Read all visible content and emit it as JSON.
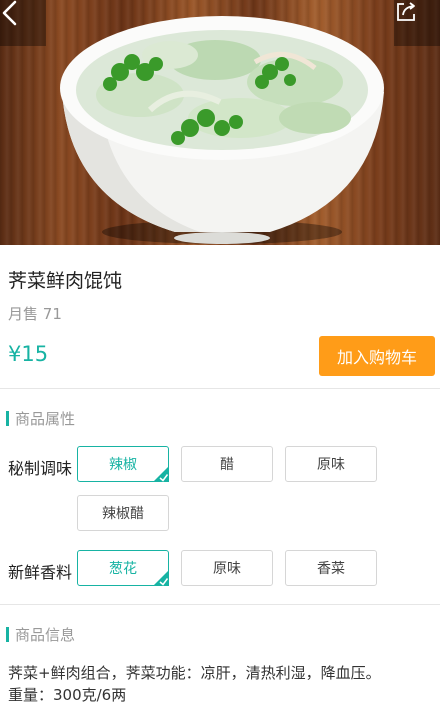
{
  "header": {
    "back_icon": "chevron-left-icon",
    "share_icon": "share-icon"
  },
  "product": {
    "name": "荠菜鲜肉馄饨",
    "sold_label": "月售",
    "sold_count": "71",
    "price": "¥15",
    "add_to_cart_label": "加入购物车"
  },
  "attributes": {
    "section_title": "商品属性",
    "groups": [
      {
        "label": "秘制调味",
        "options": [
          {
            "label": "辣椒",
            "selected": true
          },
          {
            "label": "醋",
            "selected": false
          },
          {
            "label": "原味",
            "selected": false
          },
          {
            "label": "辣椒醋",
            "selected": false
          }
        ]
      },
      {
        "label": "新鲜香料",
        "options": [
          {
            "label": "葱花",
            "selected": true
          },
          {
            "label": "原味",
            "selected": false
          },
          {
            "label": "香菜",
            "selected": false
          }
        ]
      }
    ]
  },
  "info": {
    "section_title": "商品信息",
    "description": "荠菜+鲜肉组合，荠菜功能：凉肝，清热利湿，降血压。",
    "weight": "重量：300克/6两"
  },
  "colors": {
    "accent": "#17b3a3",
    "cart_button": "#ff9c18"
  }
}
